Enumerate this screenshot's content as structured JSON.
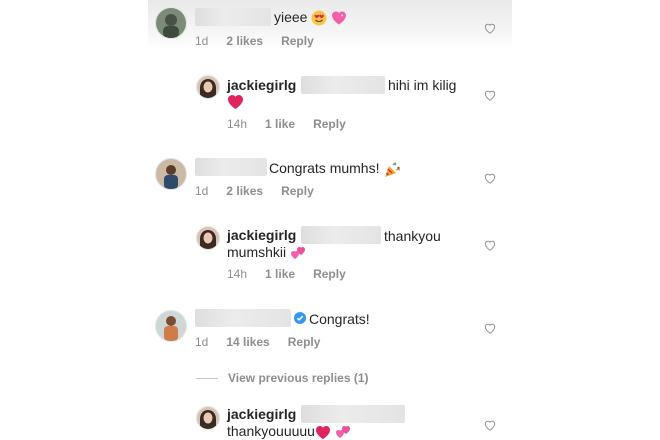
{
  "comments": [
    {
      "text": "yieee",
      "meta": {
        "time": "1d",
        "likes": "2 likes",
        "reply": "Reply"
      }
    },
    {
      "username": "jackiegirlg",
      "text_line1": "hihi im kilig",
      "meta": {
        "time": "14h",
        "likes": "1 like",
        "reply": "Reply"
      }
    },
    {
      "text": "Congrats mumhs!",
      "meta": {
        "time": "1d",
        "likes": "2 likes",
        "reply": "Reply"
      }
    },
    {
      "username": "jackiegirlg",
      "text_line1": "thankyou",
      "text_line2": "mumshkii",
      "meta": {
        "time": "14h",
        "likes": "1 like",
        "reply": "Reply"
      }
    },
    {
      "text": "Congrats!",
      "meta": {
        "time": "1d",
        "likes": "14 likes",
        "reply": "Reply"
      }
    },
    {
      "username": "jackiegirlg",
      "text_line2": "thankyouuuuu"
    }
  ],
  "view_previous_replies": "View previous replies (1)",
  "icons": {
    "like": "heart-outline-icon",
    "verified": "verified-badge-icon"
  },
  "colors": {
    "meta_gray": "#8e8e8e",
    "verified_blue": "#3897f0",
    "emoji_heart_red": "#e0245e",
    "emoji_heart_pink": "#f25fa9"
  }
}
